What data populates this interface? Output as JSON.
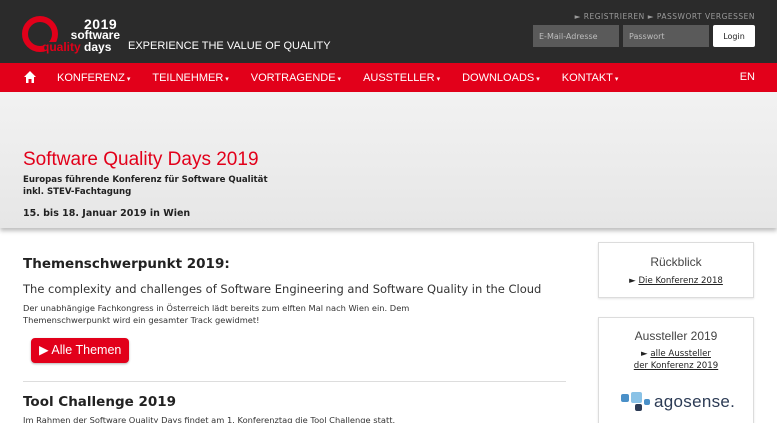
{
  "header": {
    "logo": {
      "year": "2019",
      "word_software": "software",
      "word_q": "q",
      "word_uality": "uality",
      "word_days": "days"
    },
    "tagline": "EXPERIENCE THE VALUE OF QUALITY",
    "links": {
      "register": "► REGISTRIEREN",
      "forgot": "► PASSWORT VERGESSEN"
    },
    "login": {
      "email_placeholder": "E-Mail-Adresse",
      "password_placeholder": "Passwort",
      "button": "Login"
    }
  },
  "nav": {
    "home_icon": "home-icon",
    "items": [
      "KONFERENZ",
      "TEILNEHMER",
      "VORTRAGENDE",
      "AUSSTELLER",
      "DOWNLOADS",
      "KONTAKT"
    ],
    "caret": "▾",
    "lang": "EN"
  },
  "hero": {
    "title": "Software Quality Days 2019",
    "subtitle_line1": "Europas führende Konferenz für Software Qualität",
    "subtitle_line2": "inkl. STEV-Fachtagung",
    "date": "15. bis 18. Januar 2019 in Wien"
  },
  "main": {
    "section1": {
      "heading": "Themenschwerpunkt 2019:",
      "lead": "The complexity and challenges of Software Engineering and Software Quality in the Cloud",
      "body_line1": "Der unabhängige Fachkongress in Österreich lädt bereits zum elften Mal nach Wien ein. Dem",
      "body_line2": "Themenschwerpunkt wird ein gesamter Track gewidmet!",
      "button": "▶ Alle Themen"
    },
    "section2": {
      "heading": "Tool Challenge 2019",
      "body_line1": "Im Rahmen der Software Quality Days findet am 1. Konferenztag die Tool Challenge statt."
    }
  },
  "sidebar": {
    "rueckblick": {
      "title": "Rückblick",
      "arrow": "►",
      "link": "Die Konferenz 2018"
    },
    "aussteller": {
      "title": "Aussteller 2019",
      "arrow": "►",
      "link_line1": "alle Aussteller",
      "link_line2": "der Konferenz 2019",
      "sponsor": "agosense."
    }
  },
  "colors": {
    "brand_red": "#e2001a",
    "header_dark": "#2b2b2b",
    "hero_bg": "#efefef"
  }
}
